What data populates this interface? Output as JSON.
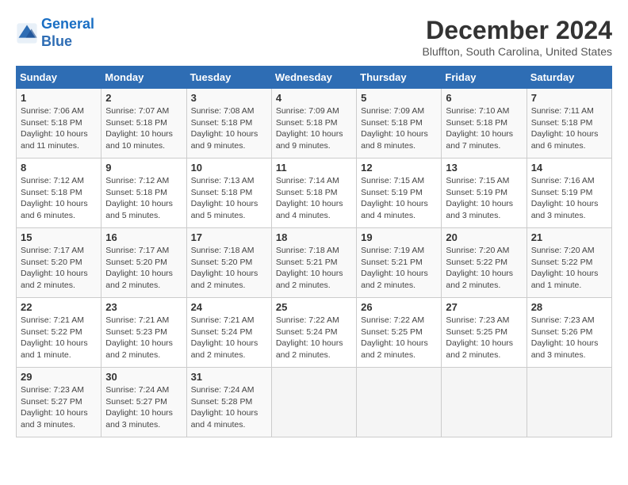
{
  "header": {
    "logo_line1": "General",
    "logo_line2": "Blue",
    "month_title": "December 2024",
    "location": "Bluffton, South Carolina, United States"
  },
  "days_of_week": [
    "Sunday",
    "Monday",
    "Tuesday",
    "Wednesday",
    "Thursday",
    "Friday",
    "Saturday"
  ],
  "weeks": [
    [
      {
        "day": "1",
        "sunrise": "7:06 AM",
        "sunset": "5:18 PM",
        "daylight": "10 hours and 11 minutes."
      },
      {
        "day": "2",
        "sunrise": "7:07 AM",
        "sunset": "5:18 PM",
        "daylight": "10 hours and 10 minutes."
      },
      {
        "day": "3",
        "sunrise": "7:08 AM",
        "sunset": "5:18 PM",
        "daylight": "10 hours and 9 minutes."
      },
      {
        "day": "4",
        "sunrise": "7:09 AM",
        "sunset": "5:18 PM",
        "daylight": "10 hours and 9 minutes."
      },
      {
        "day": "5",
        "sunrise": "7:09 AM",
        "sunset": "5:18 PM",
        "daylight": "10 hours and 8 minutes."
      },
      {
        "day": "6",
        "sunrise": "7:10 AM",
        "sunset": "5:18 PM",
        "daylight": "10 hours and 7 minutes."
      },
      {
        "day": "7",
        "sunrise": "7:11 AM",
        "sunset": "5:18 PM",
        "daylight": "10 hours and 6 minutes."
      }
    ],
    [
      {
        "day": "8",
        "sunrise": "7:12 AM",
        "sunset": "5:18 PM",
        "daylight": "10 hours and 6 minutes."
      },
      {
        "day": "9",
        "sunrise": "7:12 AM",
        "sunset": "5:18 PM",
        "daylight": "10 hours and 5 minutes."
      },
      {
        "day": "10",
        "sunrise": "7:13 AM",
        "sunset": "5:18 PM",
        "daylight": "10 hours and 5 minutes."
      },
      {
        "day": "11",
        "sunrise": "7:14 AM",
        "sunset": "5:18 PM",
        "daylight": "10 hours and 4 minutes."
      },
      {
        "day": "12",
        "sunrise": "7:15 AM",
        "sunset": "5:19 PM",
        "daylight": "10 hours and 4 minutes."
      },
      {
        "day": "13",
        "sunrise": "7:15 AM",
        "sunset": "5:19 PM",
        "daylight": "10 hours and 3 minutes."
      },
      {
        "day": "14",
        "sunrise": "7:16 AM",
        "sunset": "5:19 PM",
        "daylight": "10 hours and 3 minutes."
      }
    ],
    [
      {
        "day": "15",
        "sunrise": "7:17 AM",
        "sunset": "5:20 PM",
        "daylight": "10 hours and 2 minutes."
      },
      {
        "day": "16",
        "sunrise": "7:17 AM",
        "sunset": "5:20 PM",
        "daylight": "10 hours and 2 minutes."
      },
      {
        "day": "17",
        "sunrise": "7:18 AM",
        "sunset": "5:20 PM",
        "daylight": "10 hours and 2 minutes."
      },
      {
        "day": "18",
        "sunrise": "7:18 AM",
        "sunset": "5:21 PM",
        "daylight": "10 hours and 2 minutes."
      },
      {
        "day": "19",
        "sunrise": "7:19 AM",
        "sunset": "5:21 PM",
        "daylight": "10 hours and 2 minutes."
      },
      {
        "day": "20",
        "sunrise": "7:20 AM",
        "sunset": "5:22 PM",
        "daylight": "10 hours and 2 minutes."
      },
      {
        "day": "21",
        "sunrise": "7:20 AM",
        "sunset": "5:22 PM",
        "daylight": "10 hours and 1 minute."
      }
    ],
    [
      {
        "day": "22",
        "sunrise": "7:21 AM",
        "sunset": "5:22 PM",
        "daylight": "10 hours and 1 minute."
      },
      {
        "day": "23",
        "sunrise": "7:21 AM",
        "sunset": "5:23 PM",
        "daylight": "10 hours and 2 minutes."
      },
      {
        "day": "24",
        "sunrise": "7:21 AM",
        "sunset": "5:24 PM",
        "daylight": "10 hours and 2 minutes."
      },
      {
        "day": "25",
        "sunrise": "7:22 AM",
        "sunset": "5:24 PM",
        "daylight": "10 hours and 2 minutes."
      },
      {
        "day": "26",
        "sunrise": "7:22 AM",
        "sunset": "5:25 PM",
        "daylight": "10 hours and 2 minutes."
      },
      {
        "day": "27",
        "sunrise": "7:23 AM",
        "sunset": "5:25 PM",
        "daylight": "10 hours and 2 minutes."
      },
      {
        "day": "28",
        "sunrise": "7:23 AM",
        "sunset": "5:26 PM",
        "daylight": "10 hours and 3 minutes."
      }
    ],
    [
      {
        "day": "29",
        "sunrise": "7:23 AM",
        "sunset": "5:27 PM",
        "daylight": "10 hours and 3 minutes."
      },
      {
        "day": "30",
        "sunrise": "7:24 AM",
        "sunset": "5:27 PM",
        "daylight": "10 hours and 3 minutes."
      },
      {
        "day": "31",
        "sunrise": "7:24 AM",
        "sunset": "5:28 PM",
        "daylight": "10 hours and 4 minutes."
      },
      null,
      null,
      null,
      null
    ]
  ]
}
